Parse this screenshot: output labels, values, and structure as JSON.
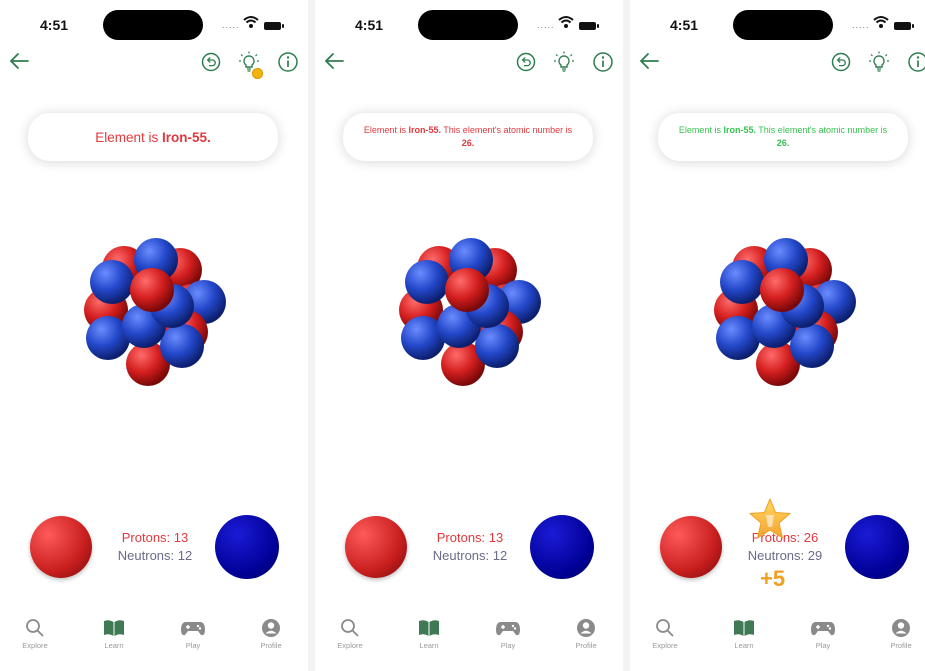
{
  "status": {
    "time": "4:51",
    "signal": "....."
  },
  "screens": [
    {
      "message": {
        "pre": "Element is ",
        "bold": "Iron-55.",
        "rest": "",
        "bold2": "",
        "post": ""
      },
      "counts": {
        "protons": "Protons: 13",
        "neutrons": "Neutrons: 12"
      },
      "message_color": "#e0393e"
    },
    {
      "message": {
        "pre": "Element is ",
        "bold": "Iron-55.",
        "rest": " This element's atomic number is ",
        "bold2": "26.",
        "post": ""
      },
      "counts": {
        "protons": "Protons: 13",
        "neutrons": "Neutrons: 12"
      },
      "message_color": "#e0393e"
    },
    {
      "message": {
        "pre": "Element is ",
        "bold": "Iron-55.",
        "rest": " This element's atomic number is ",
        "bold2": "26.",
        "post": ""
      },
      "counts": {
        "protons": "Protons: 26",
        "neutrons": "Neutrons: 29"
      },
      "message_color": "#35c14f",
      "reward": "+5"
    }
  ],
  "tabs": {
    "explore": "Explore",
    "learn": "Learn",
    "play": "Play",
    "profile": "Profile"
  },
  "icons": {
    "back": "arrow-left-icon",
    "undo": "undo-icon",
    "hint": "lightbulb-icon",
    "info": "info-icon",
    "coin": "coin-icon",
    "reward": "star-icon",
    "explore": "search-icon",
    "learn": "book-icon",
    "play": "gamepad-icon",
    "profile": "user-icon"
  },
  "colors": {
    "accent": "#2e7d4f",
    "proton": "#d62828",
    "neutron": "#1d3fbf",
    "error": "#e0393e",
    "success": "#35c14f",
    "reward": "#f0a020"
  }
}
